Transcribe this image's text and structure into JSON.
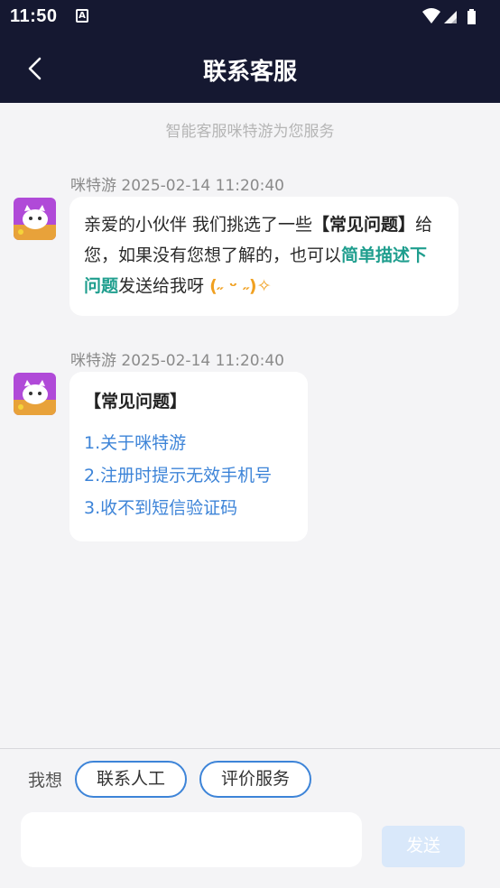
{
  "status_bar": {
    "time": "11:50",
    "a_badge": "A"
  },
  "header": {
    "title": "联系客服"
  },
  "notice": "智能客服咪特游为您服务",
  "messages": [
    {
      "sender_meta": "咪特游 2025-02-14 11:20:40",
      "parts": {
        "p1": "亲爱的小伙伴 我们挑选了一些",
        "p2": "【常见问题】",
        "p3": "给您，如果没有您想了解的，也可以",
        "p4": "简单描述下问题",
        "p5": "发送给我呀 ",
        "p6": "(˶ ᵕ ˶)✧"
      }
    },
    {
      "sender_meta": "咪特游 2025-02-14 11:20:40",
      "faq_title": "【常见问题】",
      "faq_items": [
        "1.关于咪特游",
        "2.注册时提示无效手机号",
        "3.收不到短信验证码"
      ]
    }
  ],
  "bottom": {
    "want_label": "我想",
    "chips": [
      "联系人工",
      "评价服务"
    ],
    "input_placeholder": "",
    "send_label": "发送"
  },
  "colors": {
    "header_bg": "#151831",
    "link_blue": "#3d84d8",
    "teal": "#1f9e8e",
    "orange": "#f0a020",
    "send_disabled": "#d9e8fa"
  }
}
